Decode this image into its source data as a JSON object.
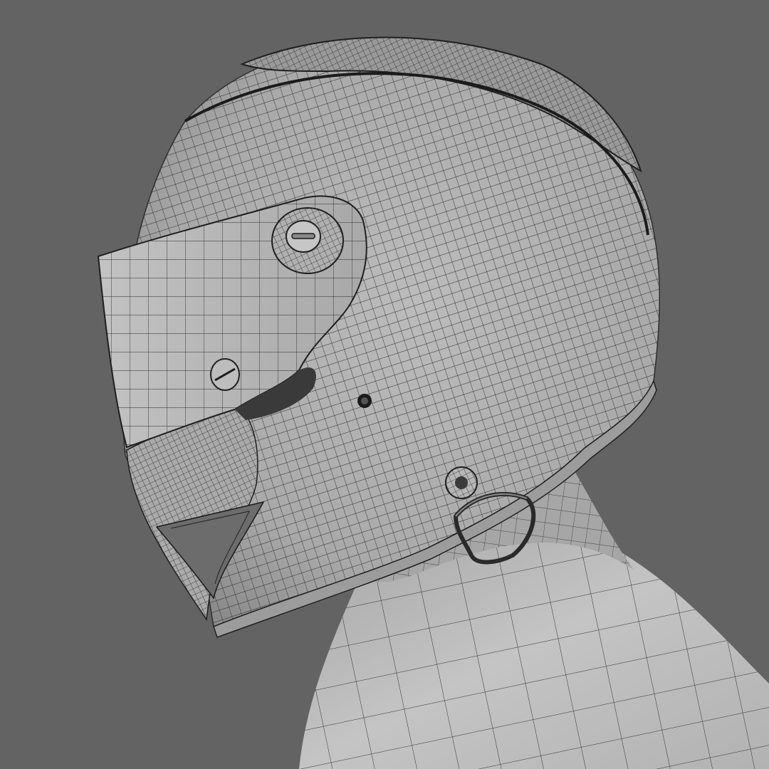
{
  "viewport": {
    "background": "#636363"
  },
  "model": {
    "subject": "motorcycle-helmet-wireframe",
    "shading": "solid-with-wireframe-overlay",
    "surface_color": "#b4b4b4",
    "wire_color": "#2a2a2a",
    "parts": [
      "helmet-shell",
      "visor",
      "visor-pivot",
      "visor-screw",
      "chin-guard",
      "vent-hole",
      "strap-rivet",
      "d-ring",
      "neck",
      "shoulder"
    ]
  }
}
